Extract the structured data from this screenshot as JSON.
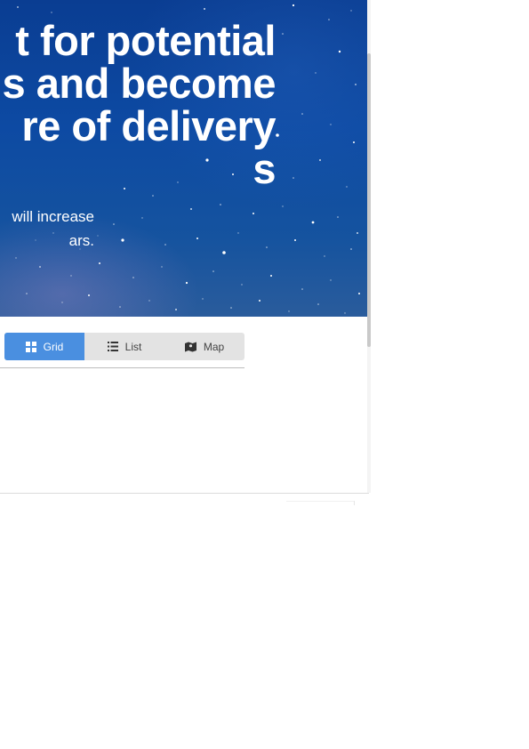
{
  "hero": {
    "headline_lines": [
      "t for potential",
      "s and become",
      "re of delivery",
      "s"
    ],
    "subtext_lines": [
      "will increase",
      "ars."
    ]
  },
  "view_toggle": {
    "active": "Grid",
    "buttons": [
      {
        "label": "Grid",
        "icon": "grid-icon"
      },
      {
        "label": "List",
        "icon": "list-icon"
      },
      {
        "label": "Map",
        "icon": "map-icon"
      }
    ]
  },
  "colors": {
    "accent": "#4a8fe0",
    "hero_blue": "#0d4aa3",
    "toggle_bg": "#e3e3e3"
  }
}
